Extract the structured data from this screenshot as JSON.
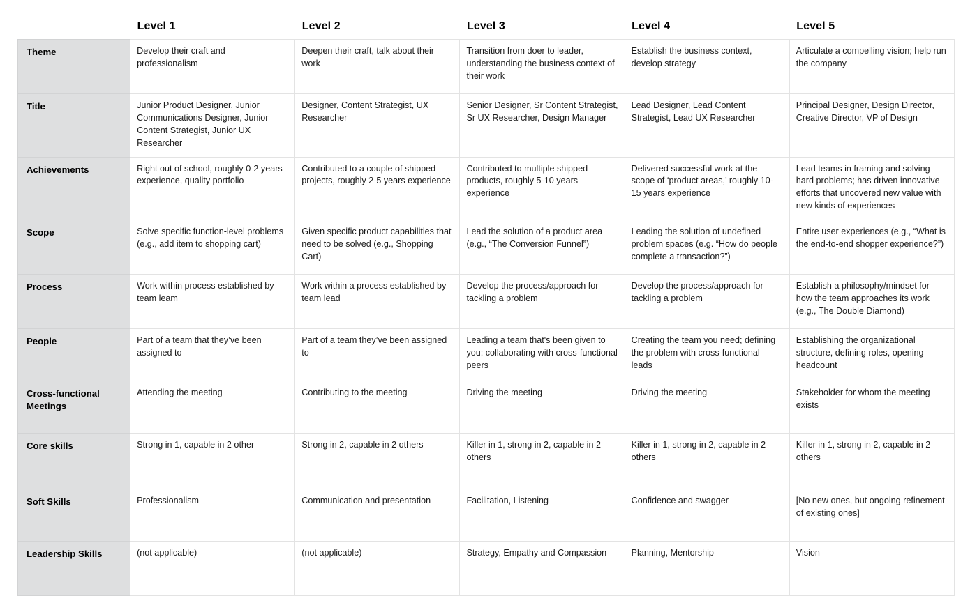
{
  "table": {
    "corner_label": "",
    "column_headers": [
      "Level 1",
      "Level 2",
      "Level 3",
      "Level 4",
      "Level 5"
    ],
    "colors": {
      "row_label_background": "#dedfe0",
      "cell_background": "#ffffff",
      "border": "#e3e3e3",
      "text": "#1b1b1b",
      "page_background": "#ffffff"
    },
    "rows": [
      {
        "label": "Theme",
        "cells": [
          "Develop their craft and professionalism",
          "Deepen their craft, talk about their work",
          "Transition from doer to leader, understanding the business context of their work",
          "Establish the business context, develop strategy",
          "Articulate a compelling vision; help run the company"
        ]
      },
      {
        "label": "Title",
        "cells": [
          "Junior Product Designer, Junior Communications Designer,  Junior Content Strategist, Junior UX Researcher",
          "Designer, Content Strategist, UX Researcher",
          "Senior Designer, Sr Content Strategist, Sr UX Researcher, Design Manager",
          "Lead Designer, Lead Content Strategist, Lead UX Researcher",
          "Principal Designer, Design Director, Creative Director, VP of Design"
        ]
      },
      {
        "label": "Achievements",
        "cells": [
          "Right out of school, roughly 0-2 years experience, quality portfolio",
          "Contributed to a couple of shipped projects, roughly 2-5 years experience",
          "Contributed to multiple shipped products, roughly 5-10 years experience",
          "Delivered successful work at the scope of ‘product areas,’ roughly 10-15 years experience",
          "Lead teams in framing and solving hard problems; has driven innovative efforts that uncovered new value with new kinds of experiences"
        ]
      },
      {
        "label": "Scope",
        "cells": [
          "Solve specific function-level problems (e.g., add item to shopping cart)",
          "Given specific product capabilities that need to be solved (e.g., Shopping Cart)",
          "Lead the solution of a product area (e.g., “The Conversion Funnel”)",
          "Leading the solution of undefined problem spaces (e.g. “How do people complete a transaction?”)",
          "Entire user experiences (e.g., “What is the end-to-end shopper experience?”)"
        ]
      },
      {
        "label": "Process",
        "cells": [
          "Work within process established by team leam",
          "Work within a process established by team lead",
          "Develop the process/approach for tackling a problem",
          "Develop the process/approach for tackling a problem",
          "Establish a philosophy/mindset for how the team approaches its work (e.g., The Double Diamond)"
        ]
      },
      {
        "label": "People",
        "cells": [
          "Part of a team that they’ve been assigned to",
          "Part of a team they’ve been assigned to",
          "Leading a team that's been given to you; collaborating with cross-functional peers",
          "Creating the team you need; defining the problem with cross-functional leads",
          "Establishing the organizational structure, defining roles, opening headcount"
        ]
      },
      {
        "label": "Cross-functional Meetings",
        "cells": [
          "Attending the meeting",
          "Contributing to the meeting",
          "Driving the meeting",
          "Driving the meeting",
          "Stakeholder for whom the meeting exists"
        ]
      },
      {
        "label": "Core skills",
        "cells": [
          "Strong in 1, capable in 2 other",
          "Strong in 2, capable in 2 others",
          "Killer in 1, strong in 2, capable in 2 others",
          "Killer in 1, strong in 2, capable in 2 others",
          "Killer in 1, strong in 2, capable in 2 others"
        ]
      },
      {
        "label": "Soft Skills",
        "cells": [
          "Professionalism",
          "Communication and presentation",
          "Facilitation, Listening",
          "Confidence and swagger",
          "[No new ones, but ongoing refinement of existing ones]"
        ]
      },
      {
        "label": "Leadership Skills",
        "cells": [
          "(not applicable)",
          "(not applicable)",
          "Strategy, Empathy and Compassion",
          "Planning, Mentorship",
          "Vision"
        ]
      }
    ]
  }
}
